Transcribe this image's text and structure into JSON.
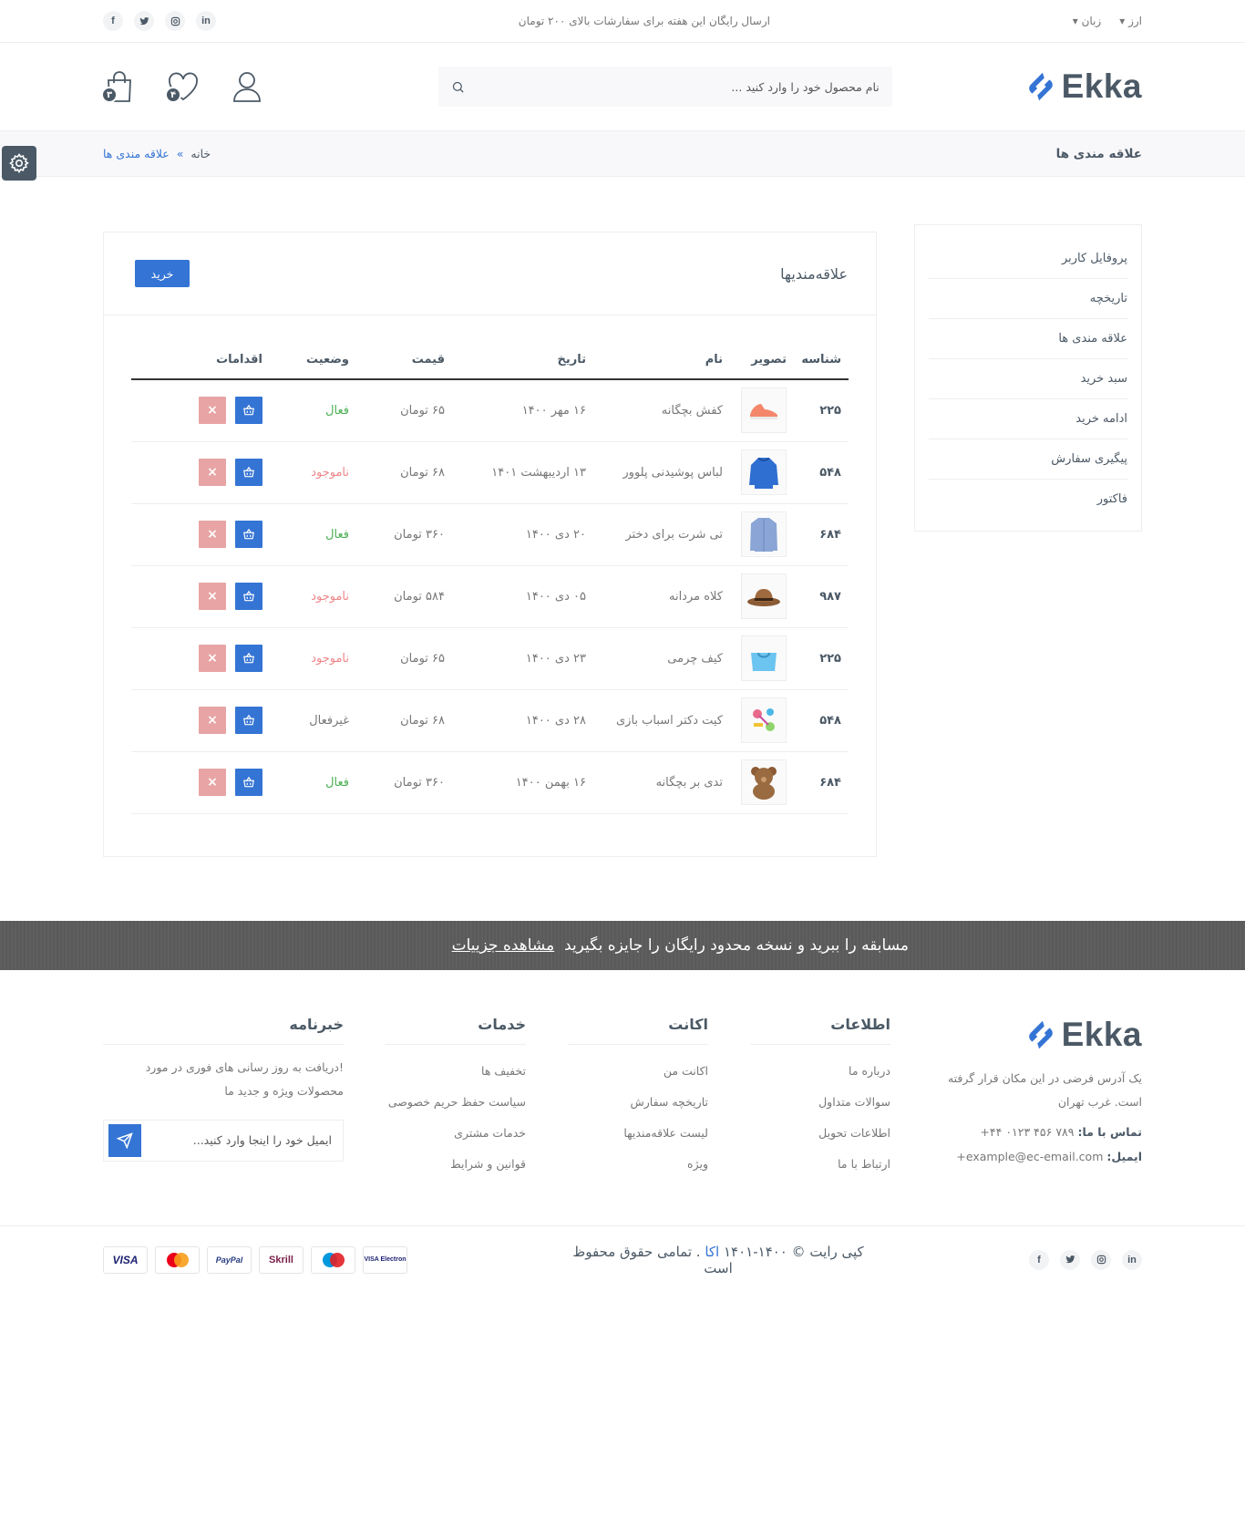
{
  "topbar": {
    "social": [
      "in",
      "ig",
      "tw",
      "f"
    ],
    "message": "ارسال رایگان این هفته برای سفارشات بالای ۲۰۰ تومان",
    "currency": "ارز",
    "language": "زبان"
  },
  "header": {
    "logo_text": "Ekka",
    "search_placeholder": "نام محصول خود را وارد کنید ...",
    "wishlist_count": "۴",
    "cart_count": "۳"
  },
  "breadcrumb": {
    "title": "علاقه مندی ها",
    "home": "خانه",
    "separator": "»",
    "current": "علاقه مندی ها"
  },
  "sidebar": {
    "items": [
      "پروفایل کاربر",
      "تاریخچه",
      "علاقه مندی ها",
      "سبد خرید",
      "ادامه خرید",
      "پیگیری سفارش",
      "فاکتور"
    ]
  },
  "wishlist": {
    "title": "علاقه‌مندیها",
    "buy_label": "خرید",
    "columns": [
      "شناسه",
      "تصویر",
      "نام",
      "تاریخ",
      "قیمت",
      "وضعیت",
      "اقدامات"
    ],
    "rows": [
      {
        "id": "۲۲۵",
        "image": "shoe",
        "name": "کفش بچگانه",
        "date": "۱۶ مهر ۱۴۰۰",
        "price": "۶۵ تومان",
        "status": "فعال",
        "status_type": "on"
      },
      {
        "id": "۵۴۸",
        "image": "hoodie",
        "name": "لباس پوشیدنی پلوور",
        "date": "۱۳ اردیبهشت ۱۴۰۱",
        "price": "۶۸ تومان",
        "status": "ناموجود",
        "status_type": "out"
      },
      {
        "id": "۶۸۴",
        "image": "shirt",
        "name": "تی شرت برای دختر",
        "date": "۲۰ دی ۱۴۰۰",
        "price": "۳۶۰ تومان",
        "status": "فعال",
        "status_type": "on"
      },
      {
        "id": "۹۸۷",
        "image": "hat",
        "name": "کلاه مردانه",
        "date": "۰۵ دی ۱۴۰۰",
        "price": "۵۸۴ تومان",
        "status": "ناموجود",
        "status_type": "out"
      },
      {
        "id": "۲۲۵",
        "image": "bag",
        "name": "کیف چرمی",
        "date": "۲۳ دی ۱۴۰۰",
        "price": "۶۵ تومان",
        "status": "ناموجود",
        "status_type": "out"
      },
      {
        "id": "۵۴۸",
        "image": "toys",
        "name": "کیت دکتر اسباب بازی",
        "date": "۲۸ دی ۱۴۰۰",
        "price": "۶۸ تومان",
        "status": "غیرفعال",
        "status_type": "off"
      },
      {
        "id": "۶۸۴",
        "image": "teddy",
        "name": "تدی بر بچگانه",
        "date": "۱۶ بهمن ۱۴۰۰",
        "price": "۳۶۰ تومان",
        "status": "فعال",
        "status_type": "on"
      }
    ]
  },
  "promo": {
    "text": "مسابقه را ببرید و نسخه محدود رایگان را جایزه بگیرید",
    "link": "مشاهده جزییات"
  },
  "footer": {
    "about": {
      "logo_text": "Ekka",
      "address": "یک آدرس فرضی در این مکان قرار گرفته است. غرب تهران",
      "phone_label": "تماس با ما:",
      "phone": "۷۸۹ ۴۵۶ ۰۱۲۳ ۴۴+",
      "email_label": "ایمیل:",
      "email": "example@ec-email.com+"
    },
    "info": {
      "title": "اطلاعات",
      "links": [
        "درباره ما",
        "سوالات متداول",
        "اطلاعات تحویل",
        "ارتباط با ما"
      ]
    },
    "account": {
      "title": "اکانت",
      "links": [
        "اکانت من",
        "تاریخچه سفارش",
        "لیست علاقه‌مندیها",
        "ویژه"
      ]
    },
    "services": {
      "title": "خدمات",
      "links": [
        "تخفیف ها",
        "سیاست حفظ حریم خصوصی",
        "خدمات مشتری",
        "قوانین و شرایط"
      ]
    },
    "newsletter": {
      "title": "خبرنامه",
      "text": "!دریافت به روز رسانی های فوری در مورد محصولات ویژه و جدید ما",
      "placeholder": "ایمیل خود را اینجا وارد کنید..."
    }
  },
  "bottom": {
    "copy_before": "کپی رایت © ۱۴۰۰-۱۴۰۱",
    "brand": "اکا",
    "copy_after": ". تمامی حقوق محفوظ است",
    "payments": [
      "VISA",
      "MasterCard",
      "PayPal",
      "Skrill",
      "Maestro",
      "VISA Electron"
    ]
  },
  "colors": {
    "accent": "#3474d4",
    "text": "#4b5966",
    "active": "#4cb054",
    "out": "#f0868a"
  }
}
